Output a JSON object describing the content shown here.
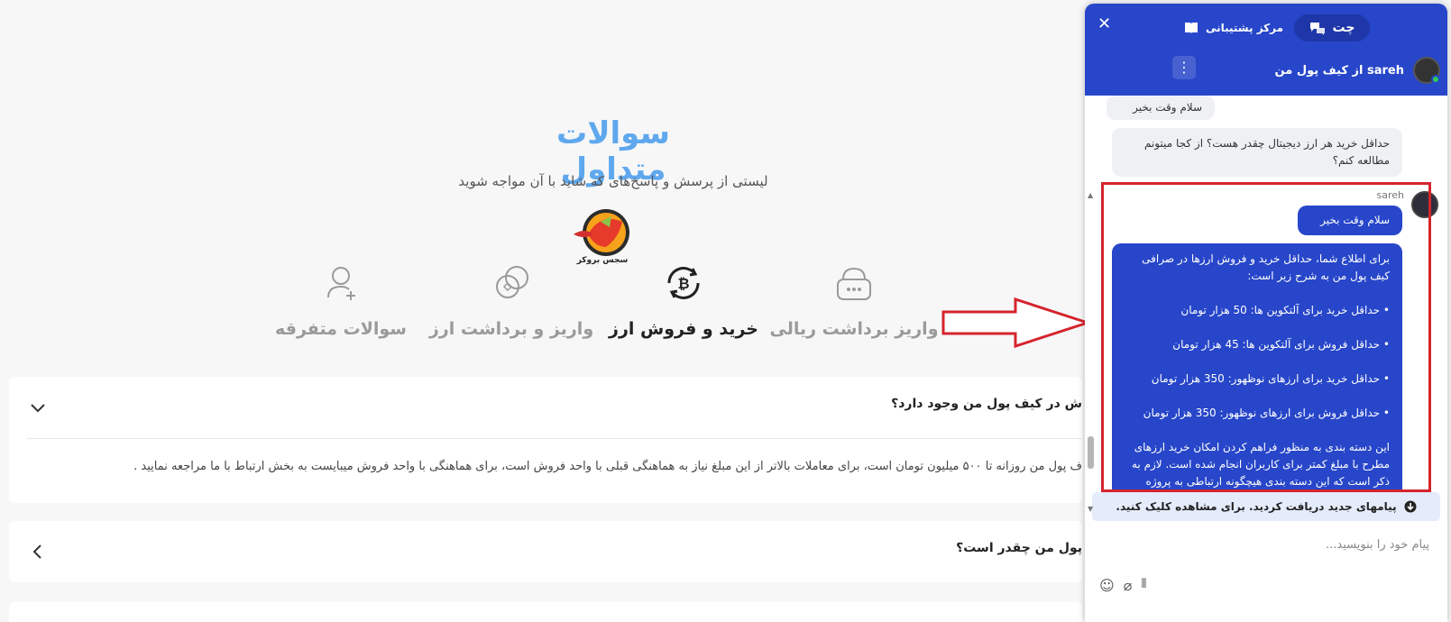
{
  "faq": {
    "title": "سوالات متداول",
    "subtitle": "لیستی از پرسش و پاسخ‌های که شاید با آن مواجه شوید",
    "logo_text": "سجس بروکر",
    "categories": [
      {
        "label": "سوالات متفرقه",
        "icon": "user-plus-icon"
      },
      {
        "label": "واریز و برداشت ارز",
        "icon": "coins-icon"
      },
      {
        "label": "خرید و فروش ارز",
        "icon": "bitcoin-exchange-icon"
      },
      {
        "label": "واریز برداشت ریالی",
        "icon": "wallet-icon"
      }
    ],
    "items": [
      {
        "question": "ش در کیف پول من وجود دارد؟",
        "answer": "ف پول من روزانه تا ۵۰۰ میلیون تومان است، برای معاملات بالاتر از این مبلغ نیاز به هماهنگی قبلی با واحد فروش است، برای هماهنگی با واحد فروش میبایست به بخش ارتباط با ما مراجعه نمایید ."
      },
      {
        "question": "پول من چقدر است؟"
      }
    ]
  },
  "chat": {
    "tab_chat": "چت",
    "tab_help": "مرکز پشتیبانی",
    "agent": "sareh از کیف پول من",
    "messages": {
      "user_greeting": "سلام وقت بخیر",
      "user_question": "حداقل خرید هر ارز دیجیتال چقدر هست؟ از کجا میتونم مطالعه کنم؟",
      "sender_name": "sareh",
      "agent_greeting": "سلام وقت بخیر",
      "agent_intro": "برای اطلاع شما، حداقل خرید و فروش ارزها در صرافی کیف پول من به شرح زیر است:",
      "agent_points": [
        "حداقل خرید برای آلتکوین ها: 50 هزار تومان",
        "حداقل فروش برای آلتکوین ها: 45 هزار تومان",
        "حداقل خرید برای ارزهای نوظهور: 350 هزار تومان",
        "حداقل فروش برای ارزهای نوظهور: 350 هزار تومان"
      ],
      "agent_outro": "این دسته بندی به منظور فراهم کردن امکان خرید ارزهای مطرح با مبلغ کمتر برای کاربران انجام شده است. لازم به ذکر است که این دسته بندی هیچگونه ارتباطی به پروژه"
    },
    "new_messages_bar": "پیامهای جدید دریافت کردید. برای مشاهده کلیک کنید.",
    "input_placeholder": "پیام خود را بنویسید...",
    "colors": {
      "header": "#2746c9",
      "highlight": "#d5242e",
      "online": "#32c95a"
    }
  }
}
